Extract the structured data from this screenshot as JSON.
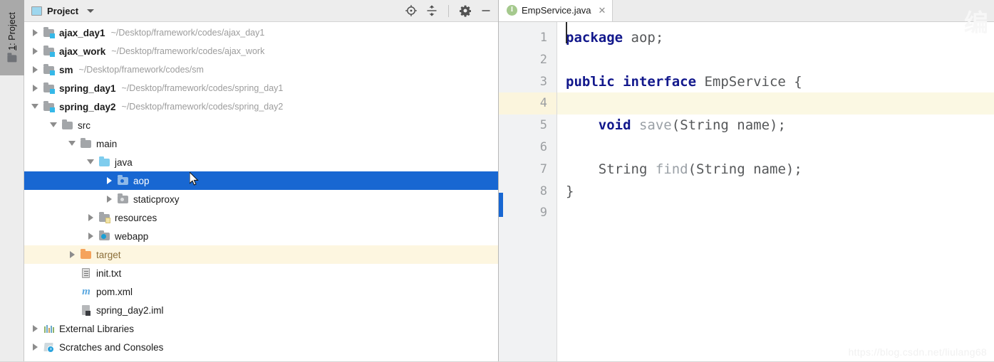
{
  "toolwindow": {
    "vertical_label_prefix": "1",
    "vertical_label": ": Project",
    "folder_icon": "folder-icon"
  },
  "panel": {
    "title": "Project",
    "dropdown_icon": "chevron-down-icon",
    "project_icon": "project-view-icon",
    "icons": [
      {
        "name": "locate-icon",
        "title": "Select Opened File"
      },
      {
        "name": "collapse-all-icon",
        "title": "Collapse All"
      },
      {
        "name": "gear-icon",
        "title": "Settings"
      },
      {
        "name": "minimize-icon",
        "title": "Hide"
      }
    ]
  },
  "tree": {
    "nodes": [
      {
        "label": "ajax_day1",
        "path": "~/Desktop/framework/codes/ajax_day1",
        "indent": 0,
        "arrow": "collapsed",
        "icon": "module-folder-icon",
        "bold": true
      },
      {
        "label": "ajax_work",
        "path": "~/Desktop/framework/codes/ajax_work",
        "indent": 0,
        "arrow": "collapsed",
        "icon": "module-folder-icon",
        "bold": true
      },
      {
        "label": "sm",
        "path": "~/Desktop/framework/codes/sm",
        "indent": 0,
        "arrow": "collapsed",
        "icon": "module-folder-icon",
        "bold": true
      },
      {
        "label": "spring_day1",
        "path": "~/Desktop/framework/codes/spring_day1",
        "indent": 0,
        "arrow": "collapsed",
        "icon": "module-folder-icon",
        "bold": true
      },
      {
        "label": "spring_day2",
        "path": "~/Desktop/framework/codes/spring_day2",
        "indent": 0,
        "arrow": "expanded",
        "icon": "module-folder-icon",
        "bold": true
      },
      {
        "label": "src",
        "path": "",
        "indent": 1,
        "arrow": "expanded",
        "icon": "folder-icon",
        "bold": false
      },
      {
        "label": "main",
        "path": "",
        "indent": 2,
        "arrow": "expanded",
        "icon": "folder-icon",
        "bold": false
      },
      {
        "label": "java",
        "path": "",
        "indent": 3,
        "arrow": "expanded",
        "icon": "source-root-icon",
        "bold": false
      },
      {
        "label": "aop",
        "path": "",
        "indent": 4,
        "arrow": "collapsed",
        "icon": "package-icon",
        "bold": false,
        "selected": true
      },
      {
        "label": "staticproxy",
        "path": "",
        "indent": 4,
        "arrow": "collapsed",
        "icon": "package-icon",
        "bold": false
      },
      {
        "label": "resources",
        "path": "",
        "indent": 3,
        "arrow": "collapsed",
        "icon": "resource-root-icon",
        "bold": false
      },
      {
        "label": "webapp",
        "path": "",
        "indent": 3,
        "arrow": "collapsed",
        "icon": "web-folder-icon",
        "bold": false
      },
      {
        "label": "target",
        "path": "",
        "indent": 2,
        "arrow": "collapsed",
        "icon": "excluded-folder-icon",
        "bold": false,
        "excluded": true
      },
      {
        "label": "init.txt",
        "path": "",
        "indent": 2,
        "arrow": "none",
        "icon": "text-file-icon",
        "bold": false
      },
      {
        "label": "pom.xml",
        "path": "",
        "indent": 2,
        "arrow": "none",
        "icon": "maven-file-icon",
        "bold": false
      },
      {
        "label": "spring_day2.iml",
        "path": "",
        "indent": 2,
        "arrow": "none",
        "icon": "module-file-icon",
        "bold": false
      },
      {
        "label": "External Libraries",
        "path": "",
        "indent": 0,
        "arrow": "collapsed",
        "icon": "libraries-icon",
        "bold": false
      },
      {
        "label": "Scratches and Consoles",
        "path": "",
        "indent": 0,
        "arrow": "collapsed",
        "icon": "scratches-icon",
        "bold": false
      }
    ]
  },
  "editor": {
    "tab": {
      "label": "EmpService.java",
      "type_icon": "interface-icon",
      "type_letter": "I",
      "close_icon": "close-icon"
    },
    "gutter_lines": [
      "1",
      "2",
      "3",
      "4",
      "5",
      "6",
      "7",
      "8",
      "9"
    ],
    "caret_line": 4,
    "lines": [
      {
        "n": 1,
        "tokens": [
          {
            "t": "package",
            "c": "kw"
          },
          {
            "t": " aop;",
            "c": "plain"
          }
        ]
      },
      {
        "n": 2,
        "tokens": []
      },
      {
        "n": 3,
        "tokens": [
          {
            "t": "public interface",
            "c": "kw"
          },
          {
            "t": " EmpService {",
            "c": "plain"
          }
        ]
      },
      {
        "n": 4,
        "tokens": []
      },
      {
        "n": 5,
        "tokens": [
          {
            "t": "    ",
            "c": "plain"
          },
          {
            "t": "void",
            "c": "kw"
          },
          {
            "t": " ",
            "c": "plain"
          },
          {
            "t": "save",
            "c": "mname"
          },
          {
            "t": "(String name);",
            "c": "plain"
          }
        ]
      },
      {
        "n": 6,
        "tokens": []
      },
      {
        "n": 7,
        "tokens": [
          {
            "t": "    String ",
            "c": "plain"
          },
          {
            "t": "find",
            "c": "mname"
          },
          {
            "t": "(String name);",
            "c": "plain"
          }
        ]
      },
      {
        "n": 8,
        "tokens": [
          {
            "t": "}",
            "c": "plain"
          }
        ]
      },
      {
        "n": 9,
        "tokens": []
      }
    ]
  },
  "watermarks": {
    "bottom_right": "https://blog.csdn.net/liulang68",
    "top_right": "编"
  },
  "colors": {
    "selection_blue": "#1867d2",
    "caret_line_yellow": "#fbf8e3",
    "excluded_orange": "#f5a35c",
    "keyword_blue": "#12188c",
    "source_root_blue": "#7fcdee"
  }
}
